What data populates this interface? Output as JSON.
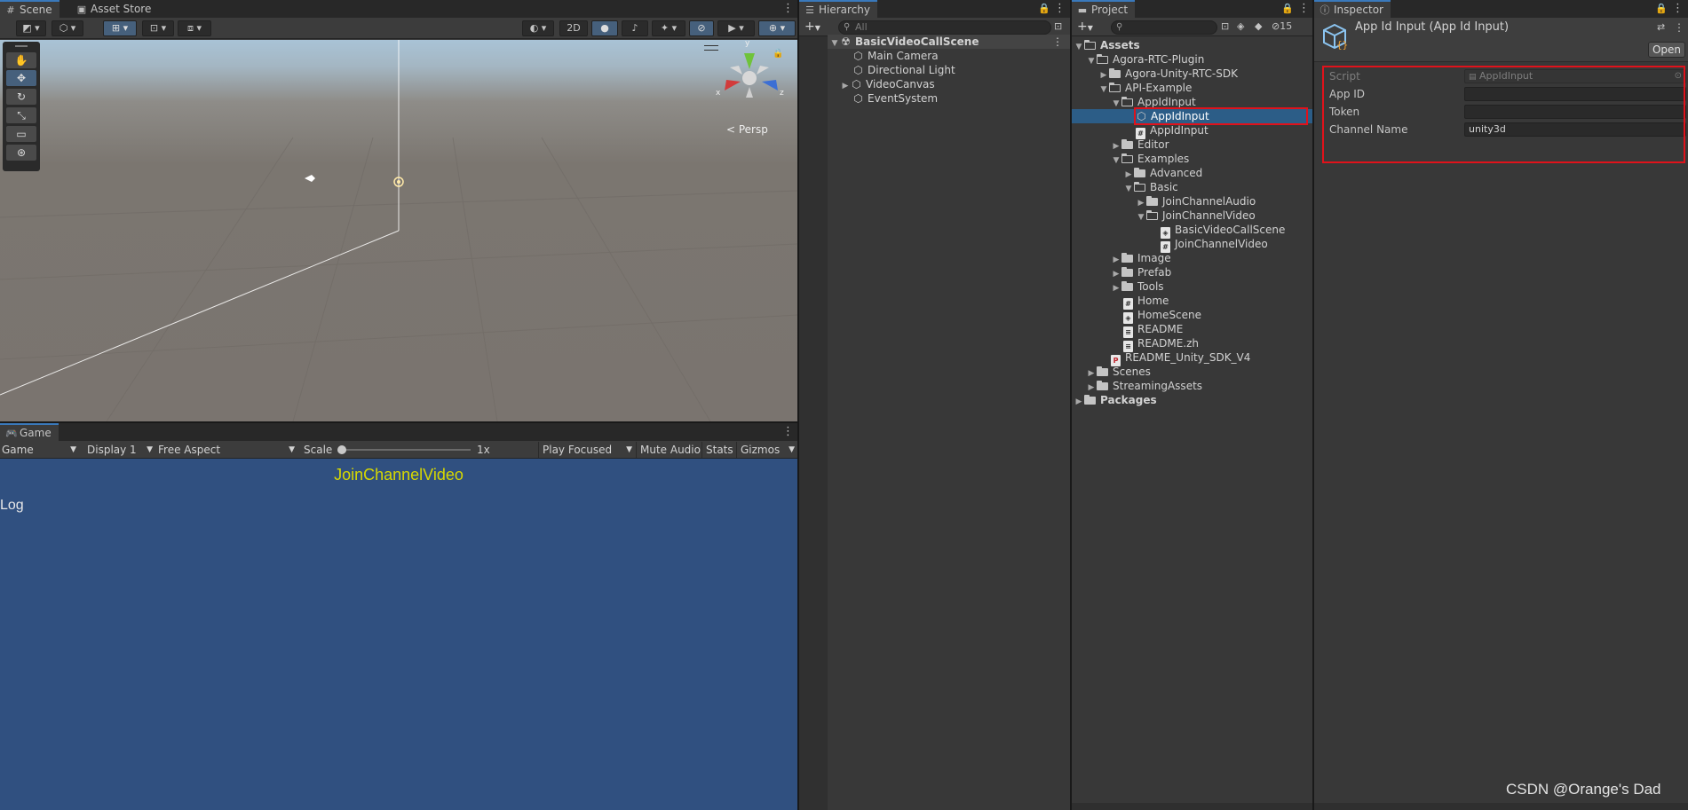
{
  "scene_tabs": {
    "scene": "Scene",
    "asset_store": "Asset Store"
  },
  "scene_toolbar": {
    "btn_2d": "2D"
  },
  "scene_view": {
    "persp_label": "< Persp",
    "gizmo_x": "x",
    "gizmo_z": "z",
    "gizmo_y": "y"
  },
  "game": {
    "tab": "Game",
    "dropdown_game": "Game",
    "display": "Display 1",
    "aspect": "Free Aspect",
    "scale_label": "Scale",
    "scale_value": "1x",
    "play_mode": "Play Focused",
    "mute": "Mute Audio",
    "stats": "Stats",
    "gizmos": "Gizmos",
    "title": "JoinChannelVideo",
    "log": "Log",
    "title_color": "#d7d800",
    "background": "#305080"
  },
  "hierarchy": {
    "tab": "Hierarchy",
    "search_placeholder": "All",
    "scene_name": "BasicVideoCallScene",
    "items": [
      "Main Camera",
      "Directional Light",
      "VideoCanvas",
      "EventSystem"
    ]
  },
  "project": {
    "tab": "Project",
    "hidden_count": "15",
    "tree": [
      {
        "label": "Assets"
      },
      {
        "label": "Agora-RTC-Plugin"
      },
      {
        "label": "Agora-Unity-RTC-SDK"
      },
      {
        "label": "API-Example"
      },
      {
        "label": "AppIdInput"
      },
      {
        "label": "AppIdInput"
      },
      {
        "label": "AppIdInput"
      },
      {
        "label": "Editor"
      },
      {
        "label": "Examples"
      },
      {
        "label": "Advanced"
      },
      {
        "label": "Basic"
      },
      {
        "label": "JoinChannelAudio"
      },
      {
        "label": "JoinChannelVideo"
      },
      {
        "label": "BasicVideoCallScene"
      },
      {
        "label": "JoinChannelVideo"
      },
      {
        "label": "Image"
      },
      {
        "label": "Prefab"
      },
      {
        "label": "Tools"
      },
      {
        "label": "Home"
      },
      {
        "label": "HomeScene"
      },
      {
        "label": "README"
      },
      {
        "label": "README.zh"
      },
      {
        "label": "README_Unity_SDK_V4"
      },
      {
        "label": "Scenes"
      },
      {
        "label": "StreamingAssets"
      },
      {
        "label": "Packages"
      }
    ]
  },
  "inspector": {
    "tab": "Inspector",
    "component_title": "App Id Input (App Id Input)",
    "open_button": "Open",
    "fields": {
      "script_label": "Script",
      "script_value": "AppIdInput",
      "app_id_label": "App ID",
      "app_id_value": "",
      "token_label": "Token",
      "token_value": "",
      "channel_label": "Channel Name",
      "channel_value": "unity3d"
    }
  },
  "watermark": "CSDN @Orange's Dad",
  "colors": {
    "selection": "#2c5d87",
    "highlight_box": "#e0121b",
    "accent_tab": "#3a79bb"
  }
}
